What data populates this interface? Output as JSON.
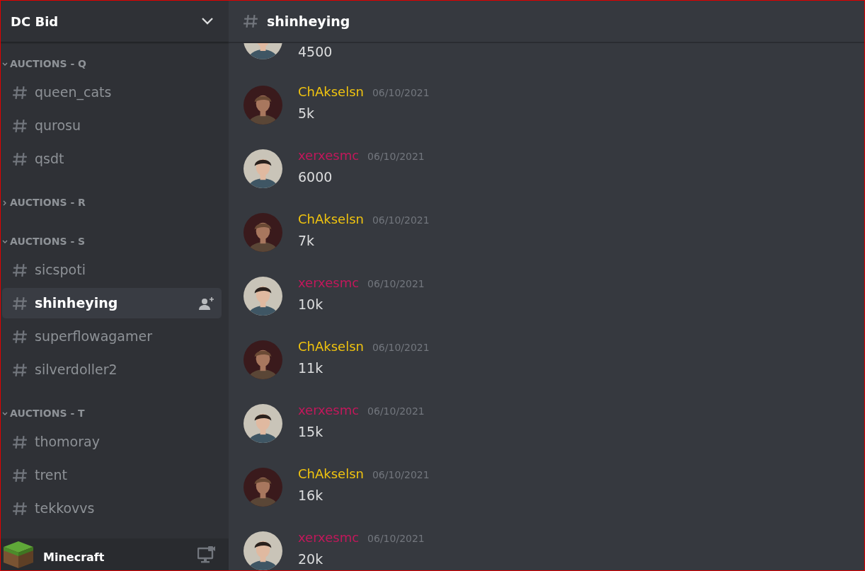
{
  "server": {
    "name": "DC Bid"
  },
  "categories": [
    {
      "name": "AUCTIONS - Q",
      "expanded": true,
      "channels": [
        {
          "name": "queen_cats",
          "selected": false
        },
        {
          "name": "qurosu",
          "selected": false
        },
        {
          "name": "qsdt",
          "selected": false
        }
      ]
    },
    {
      "name": "AUCTIONS - R",
      "expanded": false
    },
    {
      "name": "AUCTIONS - S",
      "expanded": true,
      "channels": [
        {
          "name": "sicspoti",
          "selected": false
        },
        {
          "name": "shinheying",
          "selected": true
        },
        {
          "name": "superflowagamer",
          "selected": false
        },
        {
          "name": "silverdoller2",
          "selected": false
        }
      ]
    },
    {
      "name": "AUCTIONS - T",
      "expanded": true,
      "channels": [
        {
          "name": "thomoray",
          "selected": false
        },
        {
          "name": "trent",
          "selected": false
        },
        {
          "name": "tekkovvs",
          "selected": false
        }
      ]
    }
  ],
  "activity": {
    "name": "Minecraft"
  },
  "channel_header": {
    "name": "shinheying"
  },
  "messages": [
    {
      "kind": "cut",
      "text": "4500"
    },
    {
      "kind": "full",
      "author": "ChAkselsn",
      "color": "#f1c40f",
      "time": "06/10/2021",
      "text": "5k"
    },
    {
      "kind": "full",
      "author": "xerxesmc",
      "color": "#c2185b",
      "time": "06/10/2021",
      "text": "6000"
    },
    {
      "kind": "full",
      "author": "ChAkselsn",
      "color": "#f1c40f",
      "time": "06/10/2021",
      "text": "7k"
    },
    {
      "kind": "full",
      "author": "xerxesmc",
      "color": "#c2185b",
      "time": "06/10/2021",
      "text": "10k"
    },
    {
      "kind": "full",
      "author": "ChAkselsn",
      "color": "#f1c40f",
      "time": "06/10/2021",
      "text": "11k"
    },
    {
      "kind": "full",
      "author": "xerxesmc",
      "color": "#c2185b",
      "time": "06/10/2021",
      "text": "15k"
    },
    {
      "kind": "full",
      "author": "ChAkselsn",
      "color": "#f1c40f",
      "time": "06/10/2021",
      "text": "16k"
    },
    {
      "kind": "full",
      "author": "xerxesmc",
      "color": "#c2185b",
      "time": "06/10/2021",
      "text": "20k"
    }
  ]
}
